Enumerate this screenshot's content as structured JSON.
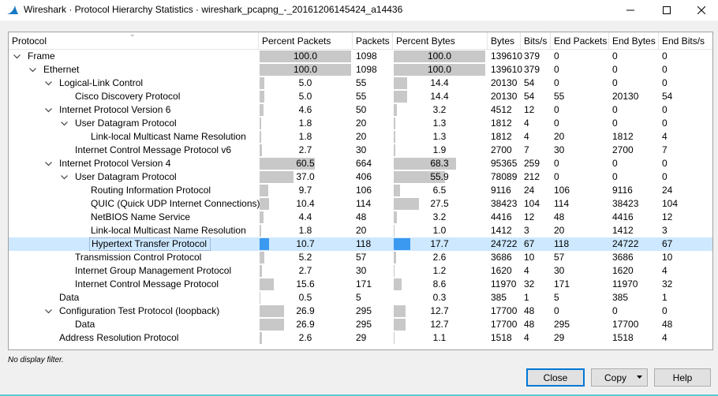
{
  "window": {
    "title": "Wireshark · Protocol Hierarchy Statistics · wireshark_pcapng_-_20161206145424_a14436"
  },
  "columns": [
    "Protocol",
    "Percent Packets",
    "Packets",
    "Percent Bytes",
    "Bytes",
    "Bits/s",
    "End Packets",
    "End Bytes",
    "End Bits/s"
  ],
  "rows": [
    {
      "protocol": "Frame",
      "depth": 0,
      "expanded": true,
      "pct_packets": "100.0",
      "pct_packets_value": 100.0,
      "packets": "1098",
      "pct_bytes": "100.0",
      "pct_bytes_value": 100.0,
      "bytes": "139610",
      "bits_s": "379",
      "end_packets": "0",
      "end_bytes": "0",
      "end_bits_s": "0"
    },
    {
      "protocol": "Ethernet",
      "depth": 1,
      "expanded": true,
      "pct_packets": "100.0",
      "pct_packets_value": 100.0,
      "packets": "1098",
      "pct_bytes": "100.0",
      "pct_bytes_value": 100.0,
      "bytes": "139610",
      "bits_s": "379",
      "end_packets": "0",
      "end_bytes": "0",
      "end_bits_s": "0"
    },
    {
      "protocol": "Logical-Link Control",
      "depth": 2,
      "expanded": true,
      "pct_packets": "5.0",
      "pct_packets_value": 5.0,
      "packets": "55",
      "pct_bytes": "14.4",
      "pct_bytes_value": 14.4,
      "bytes": "20130",
      "bits_s": "54",
      "end_packets": "0",
      "end_bytes": "0",
      "end_bits_s": "0"
    },
    {
      "protocol": "Cisco Discovery Protocol",
      "depth": 3,
      "expanded": null,
      "pct_packets": "5.0",
      "pct_packets_value": 5.0,
      "packets": "55",
      "pct_bytes": "14.4",
      "pct_bytes_value": 14.4,
      "bytes": "20130",
      "bits_s": "54",
      "end_packets": "55",
      "end_bytes": "20130",
      "end_bits_s": "54"
    },
    {
      "protocol": "Internet Protocol Version 6",
      "depth": 2,
      "expanded": true,
      "pct_packets": "4.6",
      "pct_packets_value": 4.6,
      "packets": "50",
      "pct_bytes": "3.2",
      "pct_bytes_value": 3.2,
      "bytes": "4512",
      "bits_s": "12",
      "end_packets": "0",
      "end_bytes": "0",
      "end_bits_s": "0"
    },
    {
      "protocol": "User Datagram Protocol",
      "depth": 3,
      "expanded": true,
      "pct_packets": "1.8",
      "pct_packets_value": 1.8,
      "packets": "20",
      "pct_bytes": "1.3",
      "pct_bytes_value": 1.3,
      "bytes": "1812",
      "bits_s": "4",
      "end_packets": "0",
      "end_bytes": "0",
      "end_bits_s": "0"
    },
    {
      "protocol": "Link-local Multicast Name Resolution",
      "depth": 4,
      "expanded": null,
      "pct_packets": "1.8",
      "pct_packets_value": 1.8,
      "packets": "20",
      "pct_bytes": "1.3",
      "pct_bytes_value": 1.3,
      "bytes": "1812",
      "bits_s": "4",
      "end_packets": "20",
      "end_bytes": "1812",
      "end_bits_s": "4"
    },
    {
      "protocol": "Internet Control Message Protocol v6",
      "depth": 3,
      "expanded": null,
      "pct_packets": "2.7",
      "pct_packets_value": 2.7,
      "packets": "30",
      "pct_bytes": "1.9",
      "pct_bytes_value": 1.9,
      "bytes": "2700",
      "bits_s": "7",
      "end_packets": "30",
      "end_bytes": "2700",
      "end_bits_s": "7"
    },
    {
      "protocol": "Internet Protocol Version 4",
      "depth": 2,
      "expanded": true,
      "pct_packets": "60.5",
      "pct_packets_value": 60.5,
      "packets": "664",
      "pct_bytes": "68.3",
      "pct_bytes_value": 68.3,
      "bytes": "95365",
      "bits_s": "259",
      "end_packets": "0",
      "end_bytes": "0",
      "end_bits_s": "0"
    },
    {
      "protocol": "User Datagram Protocol",
      "depth": 3,
      "expanded": true,
      "pct_packets": "37.0",
      "pct_packets_value": 37.0,
      "packets": "406",
      "pct_bytes": "55.9",
      "pct_bytes_value": 55.9,
      "bytes": "78089",
      "bits_s": "212",
      "end_packets": "0",
      "end_bytes": "0",
      "end_bits_s": "0"
    },
    {
      "protocol": "Routing Information Protocol",
      "depth": 4,
      "expanded": null,
      "pct_packets": "9.7",
      "pct_packets_value": 9.7,
      "packets": "106",
      "pct_bytes": "6.5",
      "pct_bytes_value": 6.5,
      "bytes": "9116",
      "bits_s": "24",
      "end_packets": "106",
      "end_bytes": "9116",
      "end_bits_s": "24"
    },
    {
      "protocol": "QUIC (Quick UDP Internet Connections)",
      "depth": 4,
      "expanded": null,
      "pct_packets": "10.4",
      "pct_packets_value": 10.4,
      "packets": "114",
      "pct_bytes": "27.5",
      "pct_bytes_value": 27.5,
      "bytes": "38423",
      "bits_s": "104",
      "end_packets": "114",
      "end_bytes": "38423",
      "end_bits_s": "104"
    },
    {
      "protocol": "NetBIOS Name Service",
      "depth": 4,
      "expanded": null,
      "pct_packets": "4.4",
      "pct_packets_value": 4.4,
      "packets": "48",
      "pct_bytes": "3.2",
      "pct_bytes_value": 3.2,
      "bytes": "4416",
      "bits_s": "12",
      "end_packets": "48",
      "end_bytes": "4416",
      "end_bits_s": "12"
    },
    {
      "protocol": "Link-local Multicast Name Resolution",
      "depth": 4,
      "expanded": null,
      "pct_packets": "1.8",
      "pct_packets_value": 1.8,
      "packets": "20",
      "pct_bytes": "1.0",
      "pct_bytes_value": 1.0,
      "bytes": "1412",
      "bits_s": "3",
      "end_packets": "20",
      "end_bytes": "1412",
      "end_bits_s": "3"
    },
    {
      "protocol": "Hypertext Transfer Protocol",
      "depth": 4,
      "expanded": null,
      "selected": true,
      "pct_packets": "10.7",
      "pct_packets_value": 10.7,
      "packets": "118",
      "pct_bytes": "17.7",
      "pct_bytes_value": 17.7,
      "bytes": "24722",
      "bits_s": "67",
      "end_packets": "118",
      "end_bytes": "24722",
      "end_bits_s": "67"
    },
    {
      "protocol": "Transmission Control Protocol",
      "depth": 3,
      "expanded": null,
      "pct_packets": "5.2",
      "pct_packets_value": 5.2,
      "packets": "57",
      "pct_bytes": "2.6",
      "pct_bytes_value": 2.6,
      "bytes": "3686",
      "bits_s": "10",
      "end_packets": "57",
      "end_bytes": "3686",
      "end_bits_s": "10"
    },
    {
      "protocol": "Internet Group Management Protocol",
      "depth": 3,
      "expanded": null,
      "pct_packets": "2.7",
      "pct_packets_value": 2.7,
      "packets": "30",
      "pct_bytes": "1.2",
      "pct_bytes_value": 1.2,
      "bytes": "1620",
      "bits_s": "4",
      "end_packets": "30",
      "end_bytes": "1620",
      "end_bits_s": "4"
    },
    {
      "protocol": "Internet Control Message Protocol",
      "depth": 3,
      "expanded": null,
      "pct_packets": "15.6",
      "pct_packets_value": 15.6,
      "packets": "171",
      "pct_bytes": "8.6",
      "pct_bytes_value": 8.6,
      "bytes": "11970",
      "bits_s": "32",
      "end_packets": "171",
      "end_bytes": "11970",
      "end_bits_s": "32"
    },
    {
      "protocol": "Data",
      "depth": 2,
      "expanded": null,
      "pct_packets": "0.5",
      "pct_packets_value": 0.5,
      "packets": "5",
      "pct_bytes": "0.3",
      "pct_bytes_value": 0.3,
      "bytes": "385",
      "bits_s": "1",
      "end_packets": "5",
      "end_bytes": "385",
      "end_bits_s": "1"
    },
    {
      "protocol": "Configuration Test Protocol (loopback)",
      "depth": 2,
      "expanded": true,
      "pct_packets": "26.9",
      "pct_packets_value": 26.9,
      "packets": "295",
      "pct_bytes": "12.7",
      "pct_bytes_value": 12.7,
      "bytes": "17700",
      "bits_s": "48",
      "end_packets": "0",
      "end_bytes": "0",
      "end_bits_s": "0"
    },
    {
      "protocol": "Data",
      "depth": 3,
      "expanded": null,
      "pct_packets": "26.9",
      "pct_packets_value": 26.9,
      "packets": "295",
      "pct_bytes": "12.7",
      "pct_bytes_value": 12.7,
      "bytes": "17700",
      "bits_s": "48",
      "end_packets": "295",
      "end_bytes": "17700",
      "end_bits_s": "48"
    },
    {
      "protocol": "Address Resolution Protocol",
      "depth": 2,
      "expanded": null,
      "pct_packets": "2.6",
      "pct_packets_value": 2.6,
      "packets": "29",
      "pct_bytes": "1.1",
      "pct_bytes_value": 1.1,
      "bytes": "1518",
      "bits_s": "4",
      "end_packets": "29",
      "end_bytes": "1518",
      "end_bits_s": "4"
    }
  ],
  "status": {
    "filter": "No display filter."
  },
  "buttons": {
    "close": "Close",
    "copy": "Copy",
    "help": "Help"
  },
  "icons": {
    "app": "wireshark-fin-icon",
    "minimize": "minimize-icon",
    "maximize": "maximize-icon",
    "close": "close-icon",
    "expand": "chevron-down-icon",
    "dropdown": "dropdown-arrow-icon"
  },
  "colors": {
    "selection": "#cde8ff",
    "selected_bar": "#3b99f0",
    "bar": "#c8c8c8",
    "default_button_border": "#0078d7",
    "app_icon": "#1679c5"
  }
}
